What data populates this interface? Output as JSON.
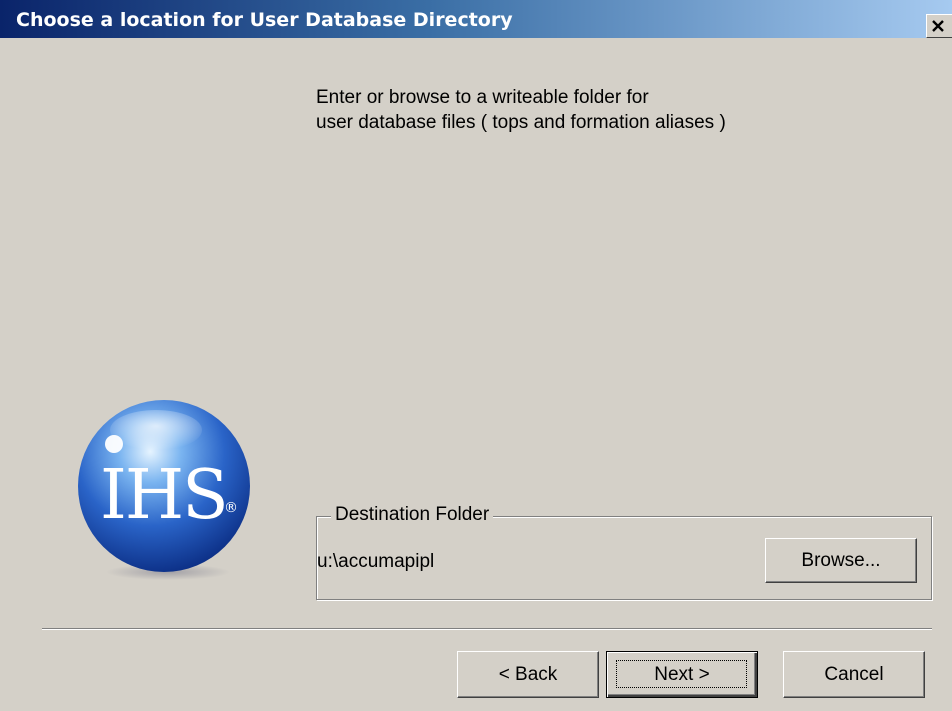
{
  "window": {
    "title": "Choose a location for User Database Directory"
  },
  "instructions": {
    "line1": "Enter or browse to a writeable folder for",
    "line2": "user database files ( tops and formation aliases )"
  },
  "logo": {
    "text": "IHS",
    "mark": "®"
  },
  "destination": {
    "legend": "Destination Folder",
    "path": "u:\\accumapipl",
    "browse_label": "Browse..."
  },
  "footer": {
    "back_label": "< Back",
    "next_label": "Next >",
    "cancel_label": "Cancel"
  },
  "colors": {
    "dialog_bg": "#d4d0c8",
    "title_start": "#0a246a",
    "title_end": "#a6caf0"
  }
}
